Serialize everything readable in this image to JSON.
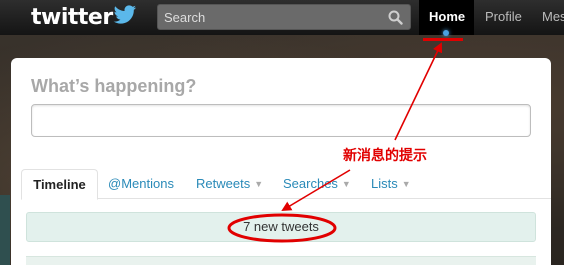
{
  "header": {
    "logo_text": "twitter",
    "search": {
      "placeholder": "Search"
    },
    "nav": [
      {
        "label": "Home"
      },
      {
        "label": "Profile"
      },
      {
        "label": "Mes"
      }
    ]
  },
  "compose": {
    "title": "What’s happening?",
    "value": ""
  },
  "tabs": [
    {
      "label": "Timeline"
    },
    {
      "label": "@Mentions"
    },
    {
      "label": "Retweets"
    },
    {
      "label": "Searches"
    },
    {
      "label": "Lists"
    }
  ],
  "timeline": {
    "new_tweets_text": "7 new tweets"
  },
  "annotation": {
    "text": "新消息的提示",
    "color": "#e10000"
  },
  "colors": {
    "accent": "#2a8ab8",
    "new_tweets_bg": "#e3f1ed",
    "annotation": "#e10000"
  },
  "icons": [
    "twitter-bird-icon",
    "search-icon",
    "caret-down-icon"
  ]
}
